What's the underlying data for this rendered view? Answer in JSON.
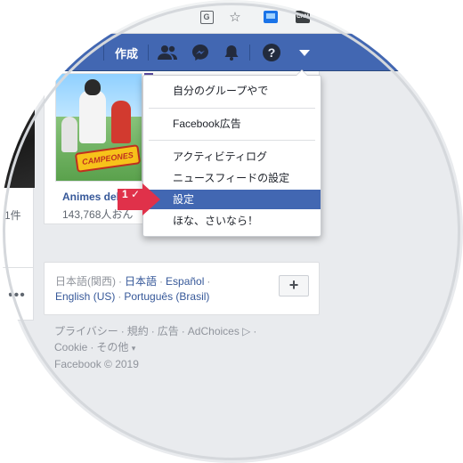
{
  "browser": {
    "toolbar_icons": [
      "translate-icon",
      "bookmark-star-icon",
      "extension-icon",
      "extension-icon"
    ],
    "translate_glyph": "G",
    "extension_text": "CAM"
  },
  "fb_nav": {
    "create_label": "作成",
    "icons": [
      "friends-icon",
      "messenger-icon",
      "notifications-bell-icon",
      "help-icon",
      "account-menu-icon"
    ],
    "help_glyph": "?",
    "accent": "#4267b2"
  },
  "left_column": {
    "count_text": "1件",
    "more_glyph": "•••"
  },
  "group_card": {
    "name": "Animes del",
    "members": "143,768人おん",
    "thumb_logo_text": "CAMPEONES"
  },
  "dropdown": {
    "items": [
      {
        "label": "自分のグループやで"
      },
      {
        "label": "Facebook広告"
      },
      {
        "label": "アクティビティログ"
      },
      {
        "label": "ニュースフィードの設定"
      },
      {
        "label": "設定",
        "selected": true
      },
      {
        "label": "ほな、さいなら！"
      }
    ],
    "highlight_color": "#4267b2"
  },
  "annotation": {
    "step": "1 ✓",
    "color": "#e0314a"
  },
  "languages": {
    "current": "日本語(関西)",
    "options": [
      "日本語",
      "Español",
      "English (US)",
      "Português (Brasil)"
    ],
    "add_button": "+"
  },
  "footer": {
    "links": [
      "プライバシー",
      "規約",
      "広告",
      "AdChoices ▷",
      "Cookie",
      "その他"
    ],
    "more_caret": "▾",
    "copyright": "Facebook © 2019"
  }
}
